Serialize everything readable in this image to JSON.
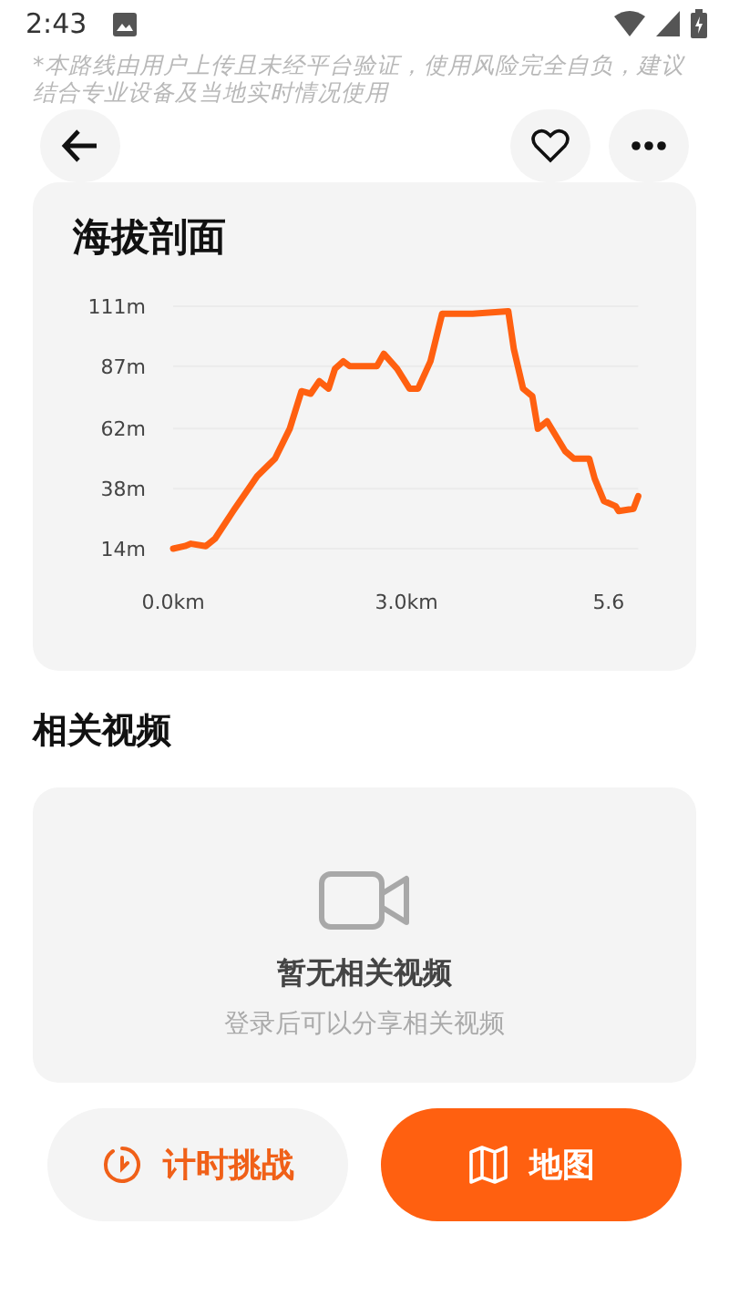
{
  "status_bar": {
    "time": "2:43"
  },
  "disclaimer": "*本路线由用户上传且未经平台验证，使用风险完全自负，建议结合专业设备及当地实时情况使用",
  "elevation": {
    "title": "海拔剖面",
    "chart_data": {
      "type": "line",
      "x": [
        0,
        0.15,
        0.23,
        0.42,
        0.54,
        0.77,
        1.08,
        1.31,
        1.5,
        1.65,
        1.77,
        1.88,
        2.0,
        2.08,
        2.19,
        2.27,
        2.62,
        2.71,
        2.88,
        3.04,
        3.15,
        3.31,
        3.46,
        3.85,
        4.31,
        4.38,
        4.5,
        4.62,
        4.69,
        4.81,
        5.04,
        5.15,
        5.35,
        5.42,
        5.54,
        5.69,
        5.73,
        5.92,
        5.98
      ],
      "series": [
        {
          "color": "#ff6010",
          "values": [
            14,
            15,
            16,
            15,
            18,
            29,
            43,
            50,
            62,
            77,
            76,
            81,
            78,
            86,
            89,
            87,
            87,
            92,
            86,
            78,
            78,
            89,
            108,
            108,
            109,
            94,
            78,
            75,
            62,
            65,
            53,
            50,
            50,
            42,
            33,
            31,
            29,
            30,
            35
          ]
        }
      ],
      "xlim": [
        0,
        5.98
      ],
      "ylim": [
        14,
        111
      ],
      "grid": true,
      "xticks": [
        {
          "value": 0,
          "label": "0.0km"
        },
        {
          "value": 3,
          "label": "3.0km"
        },
        {
          "value": 5.6,
          "label": "5.6"
        }
      ],
      "yticks": [
        {
          "value": 14,
          "label": "14m"
        },
        {
          "value": 38,
          "label": "38m"
        },
        {
          "value": 62,
          "label": "62m"
        },
        {
          "value": 87,
          "label": "87m"
        },
        {
          "value": 111,
          "label": "111m"
        }
      ]
    }
  },
  "videos": {
    "title": "相关视频",
    "empty_title": "暂无相关视频",
    "empty_hint": "登录后可以分享相关视频"
  },
  "actions": [
    {
      "label": "计时挑战",
      "kind": "timer"
    },
    {
      "label": "地图",
      "kind": "map"
    }
  ]
}
